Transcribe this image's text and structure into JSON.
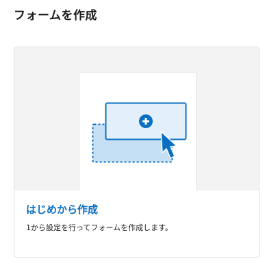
{
  "page": {
    "title": "フォームを作成"
  },
  "card": {
    "title": "はじめから作成",
    "description": "1から設定を行ってフォームを作成します。"
  },
  "colors": {
    "accent": "#0a6fc2",
    "illus_fill_front": "#e3f0fb",
    "illus_fill_back": "#c5e0f5"
  },
  "icons": [
    "add-circle-icon",
    "cursor-arrow-icon"
  ]
}
